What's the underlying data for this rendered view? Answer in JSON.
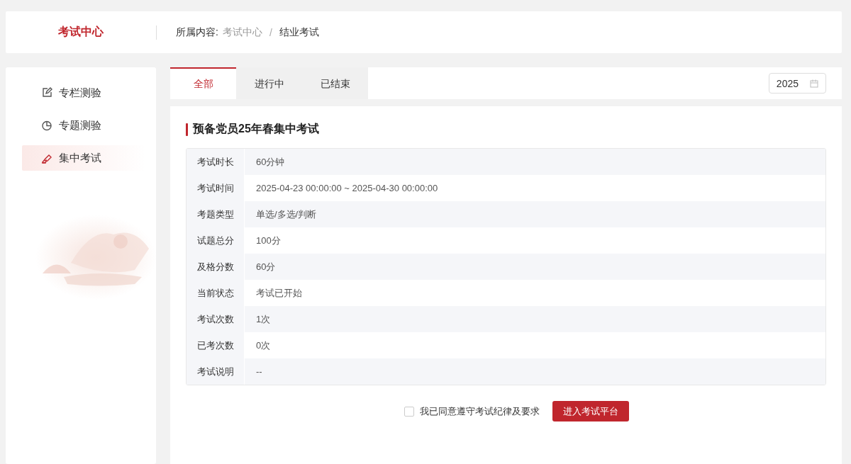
{
  "header": {
    "title": "考试中心",
    "breadcrumb_label": "所属内容:",
    "breadcrumb_separator": "/",
    "breadcrumb": [
      {
        "label": "考试中心",
        "current": false
      },
      {
        "label": "结业考试",
        "current": true
      }
    ]
  },
  "sidebar": {
    "items": [
      {
        "label": "专栏测验",
        "kind": "edit",
        "selected": false
      },
      {
        "label": "专题测验",
        "kind": "pie",
        "selected": false
      },
      {
        "label": "集中考试",
        "kind": "brush",
        "selected": true
      }
    ]
  },
  "tabs": [
    {
      "label": "全部",
      "selected": true
    },
    {
      "label": "进行中",
      "selected": false
    },
    {
      "label": "已结束",
      "selected": false
    }
  ],
  "year_picker": {
    "value": "2025"
  },
  "exam": {
    "title": "预备党员25年春集中考试",
    "details": [
      {
        "label": "考试时长",
        "value": "60分钟"
      },
      {
        "label": "考试时间",
        "value": "2025-04-23 00:00:00 ~ 2025-04-30 00:00:00"
      },
      {
        "label": "考题类型",
        "value": "单选/多选/判断"
      },
      {
        "label": "试题总分",
        "value": "100分"
      },
      {
        "label": "及格分数",
        "value": "60分"
      },
      {
        "label": "当前状态",
        "value": "考试已开始"
      },
      {
        "label": "考试次数",
        "value": "1次"
      },
      {
        "label": "已考次数",
        "value": "0次"
      },
      {
        "label": "考试说明",
        "value": "--"
      }
    ],
    "agreement": {
      "label": "我已同意遵守考试纪律及要求",
      "checked": false
    },
    "enter_button": "进入考试平台"
  }
}
